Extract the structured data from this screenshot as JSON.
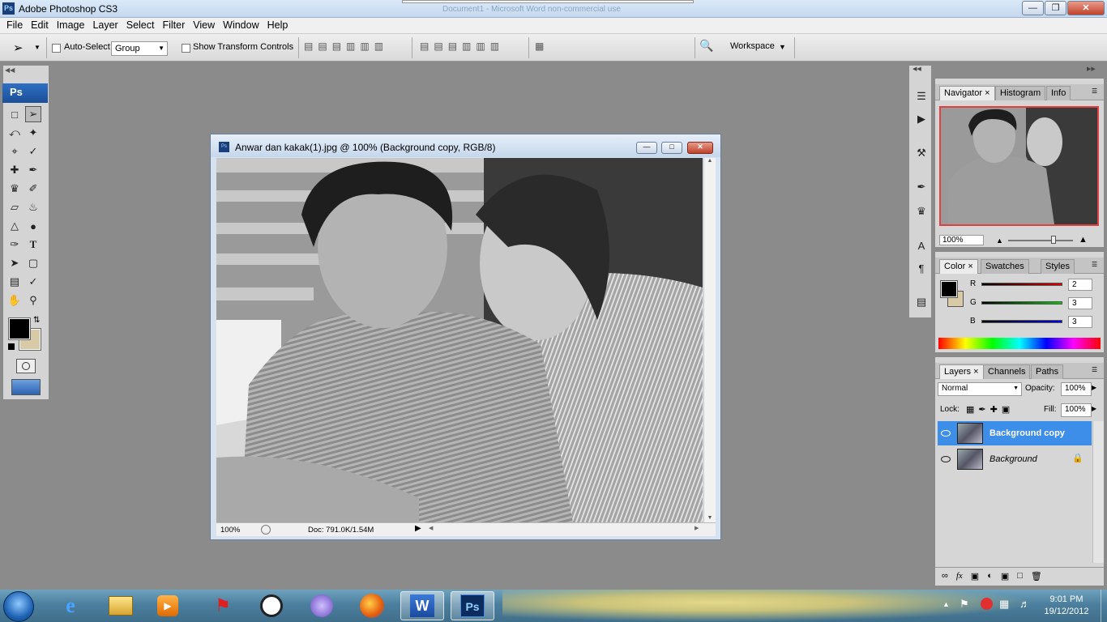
{
  "window": {
    "title": "Adobe Photoshop CS3",
    "background_title": "Document1 - Microsoft Word non-commercial use"
  },
  "menu": [
    "File",
    "Edit",
    "Image",
    "Layer",
    "Select",
    "Filter",
    "View",
    "Window",
    "Help"
  ],
  "options": {
    "auto_select_label": "Auto-Select:",
    "auto_select_value": "Group",
    "transform_label": "Show Transform Controls",
    "workspace_label": "Workspace"
  },
  "toolbox": {
    "logo": "Ps"
  },
  "document": {
    "title": "Anwar dan kakak(1).jpg @ 100% (Background copy, RGB/8)",
    "zoom": "100%",
    "doc_info": "Doc: 791.0K/1.54M"
  },
  "navigator": {
    "tabs": [
      "Navigator",
      "Histogram",
      "Info"
    ],
    "zoom": "100%",
    "zoom_level": 0.7
  },
  "color": {
    "tabs": [
      "Color",
      "Swatches",
      "Styles"
    ],
    "r_label": "R",
    "g_label": "G",
    "b_label": "B",
    "r": "2",
    "g": "3",
    "b": "3",
    "fg": "#000000",
    "bg": "#d8c9a7"
  },
  "layers": {
    "tabs": [
      "Layers",
      "Channels",
      "Paths"
    ],
    "blend_mode": "Normal",
    "opacity_label": "Opacity:",
    "opacity": "100%",
    "lock_label": "Lock:",
    "fill_label": "Fill:",
    "fill": "100%",
    "items": [
      {
        "name": "Background copy",
        "selected": true
      },
      {
        "name": "Background",
        "selected": false
      }
    ]
  },
  "taskbar": {
    "time": "9:01 PM",
    "date": "19/12/2012",
    "word_label": "W",
    "ps_label": "Ps"
  }
}
